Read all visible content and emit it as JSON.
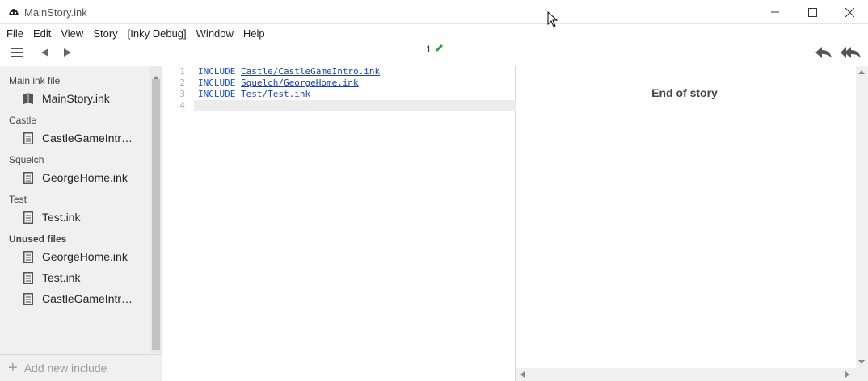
{
  "window": {
    "title": "MainStory.ink"
  },
  "menu": [
    "File",
    "Edit",
    "View",
    "Story",
    "[Inky Debug]",
    "Window",
    "Help"
  ],
  "toolbar": {
    "issue_count": "1"
  },
  "sidebar": {
    "main_heading": "Main ink file",
    "main_file": "MainStory.ink",
    "groups": [
      {
        "heading": "Castle",
        "files": [
          "CastleGameIntr…"
        ]
      },
      {
        "heading": "Squelch",
        "files": [
          "GeorgeHome.ink"
        ]
      },
      {
        "heading": "Test",
        "files": [
          "Test.ink"
        ]
      }
    ],
    "unused_heading": "Unused files",
    "unused_files": [
      "GeorgeHome.ink",
      "Test.ink",
      "CastleGameIntr…"
    ],
    "add_include": "Add new include"
  },
  "editor": {
    "lines": [
      {
        "num": "1",
        "keyword": "INCLUDE",
        "path": "Castle/CastleGameIntro.ink"
      },
      {
        "num": "2",
        "keyword": "INCLUDE",
        "path": "Squelch/GeorgeHome.ink"
      },
      {
        "num": "3",
        "keyword": "INCLUDE",
        "path": "Test/Test.ink"
      },
      {
        "num": "4",
        "keyword": "",
        "path": ""
      }
    ]
  },
  "player": {
    "end_text": "End of story"
  }
}
